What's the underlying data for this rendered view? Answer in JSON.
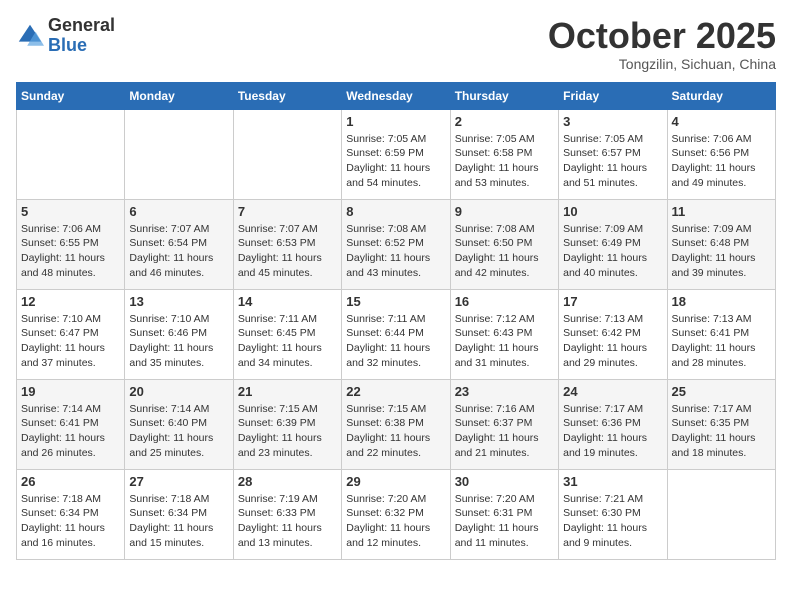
{
  "header": {
    "logo_general": "General",
    "logo_blue": "Blue",
    "month": "October 2025",
    "location": "Tongzilin, Sichuan, China"
  },
  "weekdays": [
    "Sunday",
    "Monday",
    "Tuesday",
    "Wednesday",
    "Thursday",
    "Friday",
    "Saturday"
  ],
  "weeks": [
    [
      {
        "day": "",
        "sunrise": "",
        "sunset": "",
        "daylight": ""
      },
      {
        "day": "",
        "sunrise": "",
        "sunset": "",
        "daylight": ""
      },
      {
        "day": "",
        "sunrise": "",
        "sunset": "",
        "daylight": ""
      },
      {
        "day": "1",
        "sunrise": "Sunrise: 7:05 AM",
        "sunset": "Sunset: 6:59 PM",
        "daylight": "Daylight: 11 hours and 54 minutes."
      },
      {
        "day": "2",
        "sunrise": "Sunrise: 7:05 AM",
        "sunset": "Sunset: 6:58 PM",
        "daylight": "Daylight: 11 hours and 53 minutes."
      },
      {
        "day": "3",
        "sunrise": "Sunrise: 7:05 AM",
        "sunset": "Sunset: 6:57 PM",
        "daylight": "Daylight: 11 hours and 51 minutes."
      },
      {
        "day": "4",
        "sunrise": "Sunrise: 7:06 AM",
        "sunset": "Sunset: 6:56 PM",
        "daylight": "Daylight: 11 hours and 49 minutes."
      }
    ],
    [
      {
        "day": "5",
        "sunrise": "Sunrise: 7:06 AM",
        "sunset": "Sunset: 6:55 PM",
        "daylight": "Daylight: 11 hours and 48 minutes."
      },
      {
        "day": "6",
        "sunrise": "Sunrise: 7:07 AM",
        "sunset": "Sunset: 6:54 PM",
        "daylight": "Daylight: 11 hours and 46 minutes."
      },
      {
        "day": "7",
        "sunrise": "Sunrise: 7:07 AM",
        "sunset": "Sunset: 6:53 PM",
        "daylight": "Daylight: 11 hours and 45 minutes."
      },
      {
        "day": "8",
        "sunrise": "Sunrise: 7:08 AM",
        "sunset": "Sunset: 6:52 PM",
        "daylight": "Daylight: 11 hours and 43 minutes."
      },
      {
        "day": "9",
        "sunrise": "Sunrise: 7:08 AM",
        "sunset": "Sunset: 6:50 PM",
        "daylight": "Daylight: 11 hours and 42 minutes."
      },
      {
        "day": "10",
        "sunrise": "Sunrise: 7:09 AM",
        "sunset": "Sunset: 6:49 PM",
        "daylight": "Daylight: 11 hours and 40 minutes."
      },
      {
        "day": "11",
        "sunrise": "Sunrise: 7:09 AM",
        "sunset": "Sunset: 6:48 PM",
        "daylight": "Daylight: 11 hours and 39 minutes."
      }
    ],
    [
      {
        "day": "12",
        "sunrise": "Sunrise: 7:10 AM",
        "sunset": "Sunset: 6:47 PM",
        "daylight": "Daylight: 11 hours and 37 minutes."
      },
      {
        "day": "13",
        "sunrise": "Sunrise: 7:10 AM",
        "sunset": "Sunset: 6:46 PM",
        "daylight": "Daylight: 11 hours and 35 minutes."
      },
      {
        "day": "14",
        "sunrise": "Sunrise: 7:11 AM",
        "sunset": "Sunset: 6:45 PM",
        "daylight": "Daylight: 11 hours and 34 minutes."
      },
      {
        "day": "15",
        "sunrise": "Sunrise: 7:11 AM",
        "sunset": "Sunset: 6:44 PM",
        "daylight": "Daylight: 11 hours and 32 minutes."
      },
      {
        "day": "16",
        "sunrise": "Sunrise: 7:12 AM",
        "sunset": "Sunset: 6:43 PM",
        "daylight": "Daylight: 11 hours and 31 minutes."
      },
      {
        "day": "17",
        "sunrise": "Sunrise: 7:13 AM",
        "sunset": "Sunset: 6:42 PM",
        "daylight": "Daylight: 11 hours and 29 minutes."
      },
      {
        "day": "18",
        "sunrise": "Sunrise: 7:13 AM",
        "sunset": "Sunset: 6:41 PM",
        "daylight": "Daylight: 11 hours and 28 minutes."
      }
    ],
    [
      {
        "day": "19",
        "sunrise": "Sunrise: 7:14 AM",
        "sunset": "Sunset: 6:41 PM",
        "daylight": "Daylight: 11 hours and 26 minutes."
      },
      {
        "day": "20",
        "sunrise": "Sunrise: 7:14 AM",
        "sunset": "Sunset: 6:40 PM",
        "daylight": "Daylight: 11 hours and 25 minutes."
      },
      {
        "day": "21",
        "sunrise": "Sunrise: 7:15 AM",
        "sunset": "Sunset: 6:39 PM",
        "daylight": "Daylight: 11 hours and 23 minutes."
      },
      {
        "day": "22",
        "sunrise": "Sunrise: 7:15 AM",
        "sunset": "Sunset: 6:38 PM",
        "daylight": "Daylight: 11 hours and 22 minutes."
      },
      {
        "day": "23",
        "sunrise": "Sunrise: 7:16 AM",
        "sunset": "Sunset: 6:37 PM",
        "daylight": "Daylight: 11 hours and 21 minutes."
      },
      {
        "day": "24",
        "sunrise": "Sunrise: 7:17 AM",
        "sunset": "Sunset: 6:36 PM",
        "daylight": "Daylight: 11 hours and 19 minutes."
      },
      {
        "day": "25",
        "sunrise": "Sunrise: 7:17 AM",
        "sunset": "Sunset: 6:35 PM",
        "daylight": "Daylight: 11 hours and 18 minutes."
      }
    ],
    [
      {
        "day": "26",
        "sunrise": "Sunrise: 7:18 AM",
        "sunset": "Sunset: 6:34 PM",
        "daylight": "Daylight: 11 hours and 16 minutes."
      },
      {
        "day": "27",
        "sunrise": "Sunrise: 7:18 AM",
        "sunset": "Sunset: 6:34 PM",
        "daylight": "Daylight: 11 hours and 15 minutes."
      },
      {
        "day": "28",
        "sunrise": "Sunrise: 7:19 AM",
        "sunset": "Sunset: 6:33 PM",
        "daylight": "Daylight: 11 hours and 13 minutes."
      },
      {
        "day": "29",
        "sunrise": "Sunrise: 7:20 AM",
        "sunset": "Sunset: 6:32 PM",
        "daylight": "Daylight: 11 hours and 12 minutes."
      },
      {
        "day": "30",
        "sunrise": "Sunrise: 7:20 AM",
        "sunset": "Sunset: 6:31 PM",
        "daylight": "Daylight: 11 hours and 11 minutes."
      },
      {
        "day": "31",
        "sunrise": "Sunrise: 7:21 AM",
        "sunset": "Sunset: 6:30 PM",
        "daylight": "Daylight: 11 hours and 9 minutes."
      },
      {
        "day": "",
        "sunrise": "",
        "sunset": "",
        "daylight": ""
      }
    ]
  ]
}
